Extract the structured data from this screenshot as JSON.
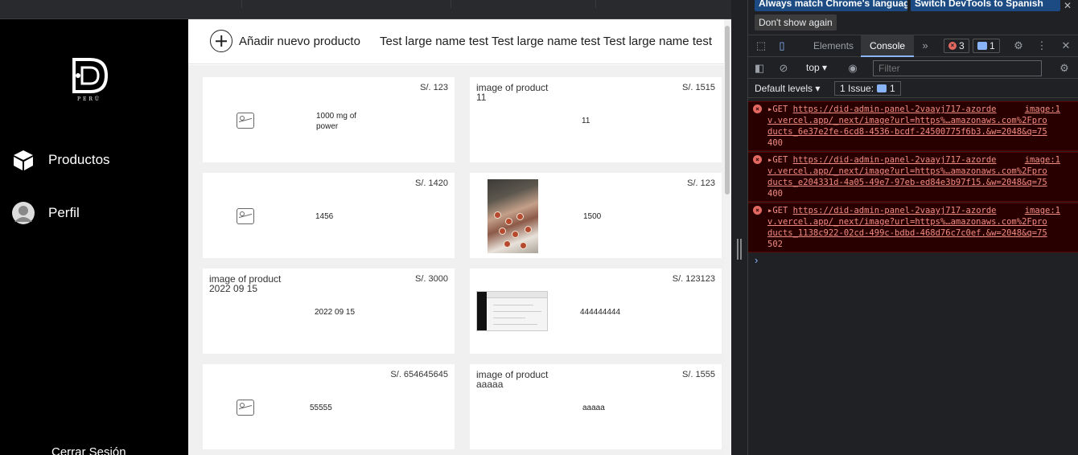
{
  "sidebar": {
    "logo_sub": "PERÚ",
    "nav": [
      {
        "label": "Productos",
        "icon": "box-icon"
      },
      {
        "label": "Perfil",
        "icon": "user-avatar-icon"
      }
    ],
    "logout": "Cerrar Sesión"
  },
  "header": {
    "add_label": "Añadir nuevo producto",
    "user_name": "Test large name test Test large name test Test large name test"
  },
  "products": [
    {
      "name": "1000 mg of power",
      "price": "S/. 123",
      "image": "placeholder"
    },
    {
      "name": "11",
      "price": "S/. 1515",
      "image": "broken",
      "alt": "image of product 11"
    },
    {
      "name": "1456",
      "price": "S/. 1420",
      "image": "placeholder"
    },
    {
      "name": "1500",
      "price": "S/. 123",
      "image": "photo"
    },
    {
      "name": "2022 09 15",
      "price": "S/. 3000",
      "image": "broken",
      "alt": "image of product 2022 09 15"
    },
    {
      "name": "444444444",
      "price": "S/. 123123",
      "image": "screenshot"
    },
    {
      "name": "55555",
      "price": "S/. 654645645",
      "image": "placeholder"
    },
    {
      "name": "aaaaa",
      "price": "S/. 1555",
      "image": "broken",
      "alt": "image of product aaaaa"
    }
  ],
  "devtools": {
    "infobar": {
      "match_language": "Always match Chrome's language",
      "switch_spanish": "Switch DevTools to Spanish",
      "dont_show": "Don't show again"
    },
    "tabs": [
      "Elements",
      "Console"
    ],
    "active_tab": "Console",
    "error_count": "3",
    "message_count": "1",
    "context": "top",
    "filter_placeholder": "Filter",
    "levels": "Default levels",
    "issues": "1 Issue:",
    "issues_count": "1",
    "errors": [
      {
        "method": "GET",
        "url_a": "https://did-admin-panel-2vaayj717-azorde",
        "url_b": "v.vercel.app/_next/image?url=https%…amazonaws.com%2Fpro",
        "url_c": "ducts_6e37e2fe-6cd8-4536-bcdf-24500775f6b3.&w=2048&q=75",
        "status": "400",
        "source": "image:1"
      },
      {
        "method": "GET",
        "url_a": "https://did-admin-panel-2vaayj717-azorde",
        "url_b": "v.vercel.app/_next/image?url=https%…amazonaws.com%2Fpro",
        "url_c": "ducts_e204331d-4a05-49e7-97eb-ed84e3b97f15.&w=2048&q=75",
        "status": "400",
        "source": "image:1"
      },
      {
        "method": "GET",
        "url_a": "https://did-admin-panel-2vaayj717-azorde",
        "url_b": "v.vercel.app/_next/image?url=https%…amazonaws.com%2Fpro",
        "url_c": "ducts_1138c922-02cd-499c-bdbd-468d76c7c0ef.&w=2048&q=75",
        "status": "502",
        "source": "image:1"
      }
    ]
  }
}
